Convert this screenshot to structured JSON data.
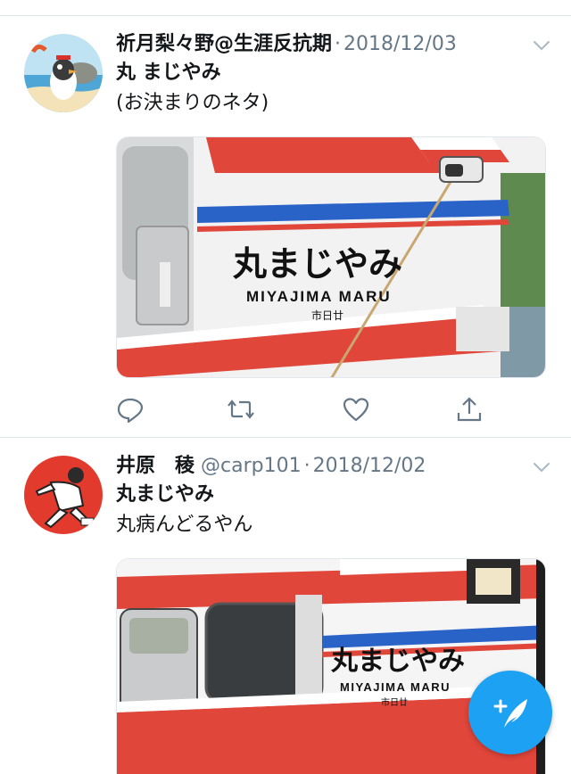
{
  "tweets": [
    {
      "display_name": "祈月梨々野@生涯反抗期",
      "handle": "",
      "separator": "·",
      "date": "2018/12/03",
      "text_line1": "丸 まじやみ",
      "text_line2": "(お決まりのネタ)",
      "media": {
        "kanji_text": "丸まじやみ",
        "latin_text": "MIYAJIMA MARU",
        "small_text": "市日廿"
      }
    },
    {
      "display_name": "井原　稜",
      "handle": "@carp101",
      "separator": "·",
      "date": "2018/12/02",
      "text_line1": "丸まじやみ",
      "text_line2": "丸病んどるやん",
      "media": {
        "kanji_text": "丸まじやみ",
        "latin_text": "MIYAJIMA MARU",
        "small_text": "市日廿"
      }
    }
  ],
  "icons": {
    "reply": "reply-icon",
    "retweet": "retweet-icon",
    "like": "heart-icon",
    "share": "share-icon",
    "more": "chevron-down-icon",
    "compose": "compose-tweet-icon"
  },
  "colors": {
    "accent": "#1da1f2",
    "secondary_text": "#657786",
    "ship_red": "#e0463a",
    "ship_blue": "#2a63c8"
  }
}
